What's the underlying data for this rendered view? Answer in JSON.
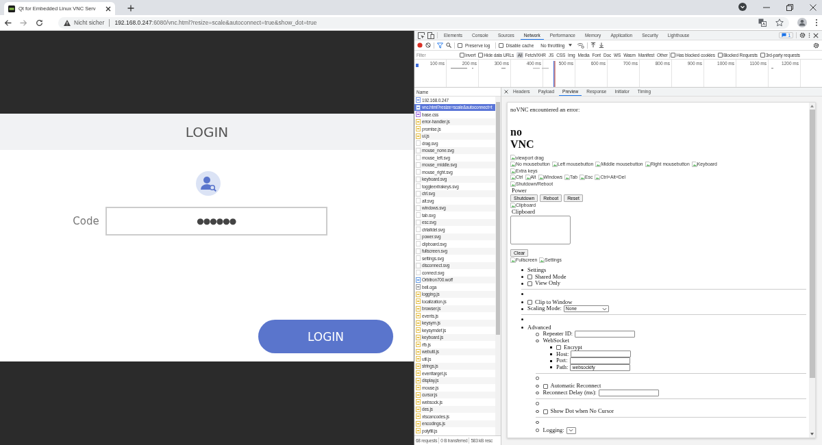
{
  "browser": {
    "tab": {
      "title": "Qt for Embedded Linux VNC Serv"
    },
    "address": {
      "security": "Nicht sicher",
      "host": "192.168.0.247",
      "path": ":6080/vnc.html?resize=scale&autoconnect=true&show_dot=true"
    }
  },
  "page": {
    "header": "LOGIN",
    "code_label": "Code",
    "code_value": "●●●●●●",
    "login_button": "LOGIN"
  },
  "devtools": {
    "tabs": [
      {
        "label": "Elements",
        "selected": false
      },
      {
        "label": "Console",
        "selected": false
      },
      {
        "label": "Sources",
        "selected": false
      },
      {
        "label": "Network",
        "selected": true
      },
      {
        "label": "Performance",
        "selected": false
      },
      {
        "label": "Memory",
        "selected": false
      },
      {
        "label": "Application",
        "selected": false
      },
      {
        "label": "Security",
        "selected": false
      },
      {
        "label": "Lighthouse",
        "selected": false
      }
    ],
    "issues_badge": "1",
    "toolbar_checks": [
      {
        "label": "Preserve log",
        "checked": false
      },
      {
        "label": "Disable cache",
        "checked": false
      }
    ],
    "throttling": "No throttling",
    "filter_placeholder": "Filter",
    "filter_checks": [
      {
        "label": "Invert",
        "checked": false
      },
      {
        "label": "Hide data URLs",
        "checked": false
      }
    ],
    "types": [
      {
        "label": "All",
        "selected": true
      },
      {
        "label": "Fetch/XHR",
        "selected": false
      },
      {
        "label": "JS",
        "selected": false
      },
      {
        "label": "CSS",
        "selected": false
      },
      {
        "label": "Img",
        "selected": false
      },
      {
        "label": "Media",
        "selected": false
      },
      {
        "label": "Font",
        "selected": false
      },
      {
        "label": "Doc",
        "selected": false
      },
      {
        "label": "WS",
        "selected": false
      },
      {
        "label": "Wasm",
        "selected": false
      },
      {
        "label": "Manifest",
        "selected": false
      },
      {
        "label": "Other",
        "selected": false
      }
    ],
    "filter_checks_after": [
      {
        "label": "Has blocked cookies",
        "checked": false
      },
      {
        "label": "Blocked Requests",
        "checked": false
      },
      {
        "label": "3rd-party requests",
        "checked": false
      }
    ],
    "timeline_ticks": [
      "100 ms",
      "200 ms",
      "300 ms",
      "400 ms",
      "500 ms",
      "600 ms",
      "700 ms",
      "800 ms",
      "900 ms",
      "1000 ms",
      "1100 ms",
      "1200 ms"
    ],
    "name_header": "Name",
    "requests": [
      {
        "name": "192.168.0.247",
        "kind": "doc",
        "selected": false
      },
      {
        "name": "vnc.html?resize=scale&autoconnect=t",
        "kind": "doc",
        "selected": true
      },
      {
        "name": "base.css",
        "kind": "css",
        "selected": false
      },
      {
        "name": "error-handler.js",
        "kind": "js",
        "selected": false
      },
      {
        "name": "promise.js",
        "kind": "js",
        "selected": false
      },
      {
        "name": "ui.js",
        "kind": "js",
        "selected": false
      },
      {
        "name": "drag.svg",
        "kind": "svg",
        "selected": false
      },
      {
        "name": "mouse_none.svg",
        "kind": "svg",
        "selected": false
      },
      {
        "name": "mouse_left.svg",
        "kind": "svg",
        "selected": false
      },
      {
        "name": "mouse_middle.svg",
        "kind": "svg",
        "selected": false
      },
      {
        "name": "mouse_right.svg",
        "kind": "svg",
        "selected": false
      },
      {
        "name": "keyboard.svg",
        "kind": "svg",
        "selected": false
      },
      {
        "name": "toggleextrakeys.svg",
        "kind": "svg",
        "selected": false
      },
      {
        "name": "ctrl.svg",
        "kind": "svg",
        "selected": false
      },
      {
        "name": "alt.svg",
        "kind": "svg",
        "selected": false
      },
      {
        "name": "windows.svg",
        "kind": "svg",
        "selected": false
      },
      {
        "name": "tab.svg",
        "kind": "svg",
        "selected": false
      },
      {
        "name": "esc.svg",
        "kind": "svg",
        "selected": false
      },
      {
        "name": "ctrlaltdel.svg",
        "kind": "svg",
        "selected": false
      },
      {
        "name": "power.svg",
        "kind": "svg",
        "selected": false
      },
      {
        "name": "clipboard.svg",
        "kind": "svg",
        "selected": false
      },
      {
        "name": "fullscreen.svg",
        "kind": "svg",
        "selected": false
      },
      {
        "name": "settings.svg",
        "kind": "svg",
        "selected": false
      },
      {
        "name": "disconnect.svg",
        "kind": "svg",
        "selected": false
      },
      {
        "name": "connect.svg",
        "kind": "svg",
        "selected": false
      },
      {
        "name": "Orbitron700.woff",
        "kind": "font",
        "selected": false
      },
      {
        "name": "bell.oga",
        "kind": "media",
        "selected": false
      },
      {
        "name": "logging.js",
        "kind": "js",
        "selected": false
      },
      {
        "name": "localization.js",
        "kind": "js",
        "selected": false
      },
      {
        "name": "browser.js",
        "kind": "js",
        "selected": false
      },
      {
        "name": "events.js",
        "kind": "js",
        "selected": false
      },
      {
        "name": "keysym.js",
        "kind": "js",
        "selected": false
      },
      {
        "name": "keysymdef.js",
        "kind": "js",
        "selected": false
      },
      {
        "name": "keyboard.js",
        "kind": "js",
        "selected": false
      },
      {
        "name": "rfb.js",
        "kind": "js",
        "selected": false
      },
      {
        "name": "webutil.js",
        "kind": "js",
        "selected": false
      },
      {
        "name": "util.js",
        "kind": "js",
        "selected": false
      },
      {
        "name": "strings.js",
        "kind": "js",
        "selected": false
      },
      {
        "name": "eventtarget.js",
        "kind": "js",
        "selected": false
      },
      {
        "name": "display.js",
        "kind": "js",
        "selected": false
      },
      {
        "name": "mouse.js",
        "kind": "js",
        "selected": false
      },
      {
        "name": "cursor.js",
        "kind": "js",
        "selected": false
      },
      {
        "name": "websock.js",
        "kind": "js",
        "selected": false
      },
      {
        "name": "des.js",
        "kind": "js",
        "selected": false
      },
      {
        "name": "xtscancodes.js",
        "kind": "js",
        "selected": false
      },
      {
        "name": "encodings.js",
        "kind": "js",
        "selected": false
      },
      {
        "name": "polyfill.js",
        "kind": "js",
        "selected": false
      }
    ],
    "status": [
      "68 requests",
      "0 B transferred",
      "583 kB resc"
    ],
    "detail_tabs": [
      {
        "label": "Headers",
        "selected": false
      },
      {
        "label": "Payload",
        "selected": false
      },
      {
        "label": "Preview",
        "selected": true
      },
      {
        "label": "Response",
        "selected": false
      },
      {
        "label": "Initiator",
        "selected": false
      },
      {
        "label": "Timing",
        "selected": false
      }
    ],
    "preview": {
      "error_text": "noVNC encountered an error:",
      "title_lines": [
        "no",
        "VNC"
      ],
      "image_rows_top": [
        [
          "viewport drag"
        ],
        [
          "No mousebutton",
          "Left mousebutton",
          "Middle mousebutton",
          "Right mousebutton",
          "Keyboard"
        ],
        [
          "Extra keys"
        ],
        [
          "Ctrl",
          "Alt",
          "Windows",
          "Tab",
          "Esc",
          "Ctrl+Alt+Del"
        ],
        [
          "Shutdown/Reboot"
        ]
      ],
      "power_label": "Power",
      "power_buttons": [
        "Shutdown",
        "Reboot",
        "Reset"
      ],
      "clipboard_image": "Clipboard",
      "clipboard_label": "Clipboard",
      "clear_button": "Clear",
      "image_row_bottom": [
        "Fullscreen",
        "Settings"
      ],
      "settings": [
        {
          "kind": "text",
          "label": "Settings"
        },
        {
          "kind": "checkbox",
          "label": "Shared Mode",
          "checked": false
        },
        {
          "kind": "checkbox",
          "label": "View Only",
          "checked": false
        },
        {
          "kind": "separator"
        },
        {
          "kind": "checkbox",
          "label": "Clip to Window",
          "checked": false
        },
        {
          "kind": "select",
          "label": "Scaling Mode:",
          "value": "None"
        },
        {
          "kind": "separator"
        },
        {
          "kind": "text",
          "label": "Advanced",
          "children": [
            {
              "kind": "input",
              "label": "Repeater ID:"
            },
            {
              "kind": "text",
              "label": "WebSocket",
              "children": [
                {
                  "kind": "checkbox",
                  "label": "Encrypt",
                  "checked": false
                },
                {
                  "kind": "input",
                  "label": "Host:"
                },
                {
                  "kind": "input",
                  "label": "Port:"
                },
                {
                  "kind": "input",
                  "label": "Path:",
                  "value": "websockify"
                }
              ]
            },
            {
              "kind": "separator"
            },
            {
              "kind": "checkbox",
              "label": "Automatic Reconnect",
              "checked": false
            },
            {
              "kind": "input",
              "label": "Reconnect Delay (ms):"
            },
            {
              "kind": "separator"
            },
            {
              "kind": "checkbox",
              "label": "Show Dot when No Cursor",
              "checked": false
            },
            {
              "kind": "separator"
            },
            {
              "kind": "select",
              "label": "Logging:"
            }
          ]
        }
      ]
    }
  }
}
